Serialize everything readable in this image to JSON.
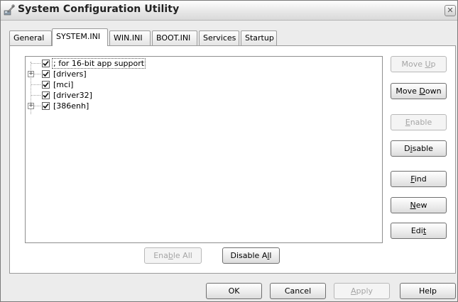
{
  "window": {
    "title": "System Configuration Utility",
    "close_glyph": "✕"
  },
  "tabs": [
    {
      "label": "General",
      "active": false
    },
    {
      "label": "SYSTEM.INI",
      "active": true
    },
    {
      "label": "WIN.INI",
      "active": false
    },
    {
      "label": "BOOT.INI",
      "active": false
    },
    {
      "label": "Services",
      "active": false
    },
    {
      "label": "Startup",
      "active": false
    }
  ],
  "tree": {
    "items": [
      {
        "label": "; for 16-bit app support",
        "checked": true,
        "expandable": false,
        "selected": true
      },
      {
        "label": "[drivers]",
        "checked": true,
        "expandable": true,
        "selected": false
      },
      {
        "label": "[mci]",
        "checked": true,
        "expandable": false,
        "selected": false
      },
      {
        "label": "[driver32]",
        "checked": true,
        "expandable": false,
        "selected": false
      },
      {
        "label": "[386enh]",
        "checked": true,
        "expandable": true,
        "selected": false
      }
    ]
  },
  "side_buttons": {
    "move_up": {
      "pre": "Move ",
      "key": "U",
      "post": "p",
      "enabled": false
    },
    "move_down": {
      "pre": "Move ",
      "key": "D",
      "post": "own",
      "enabled": true
    },
    "enable": {
      "pre": "",
      "key": "E",
      "post": "nable",
      "enabled": false
    },
    "disable": {
      "pre": "D",
      "key": "i",
      "post": "sable",
      "enabled": true
    },
    "find": {
      "pre": "",
      "key": "F",
      "post": "ind",
      "enabled": true
    },
    "new": {
      "pre": "",
      "key": "N",
      "post": "ew",
      "enabled": true
    },
    "edit": {
      "pre": "Edi",
      "key": "t",
      "post": "",
      "enabled": true
    }
  },
  "panel_buttons": {
    "enable_all": {
      "pre": "Ena",
      "key": "b",
      "post": "le All",
      "enabled": false
    },
    "disable_all": {
      "pre": "Disable A",
      "key": "l",
      "post": "l",
      "enabled": true
    }
  },
  "dialog_buttons": {
    "ok": {
      "label": "OK",
      "enabled": true
    },
    "cancel": {
      "label": "Cancel",
      "enabled": true
    },
    "apply": {
      "pre": "",
      "key": "A",
      "post": "pply",
      "enabled": false
    },
    "help": {
      "label": "Help",
      "enabled": true
    }
  }
}
